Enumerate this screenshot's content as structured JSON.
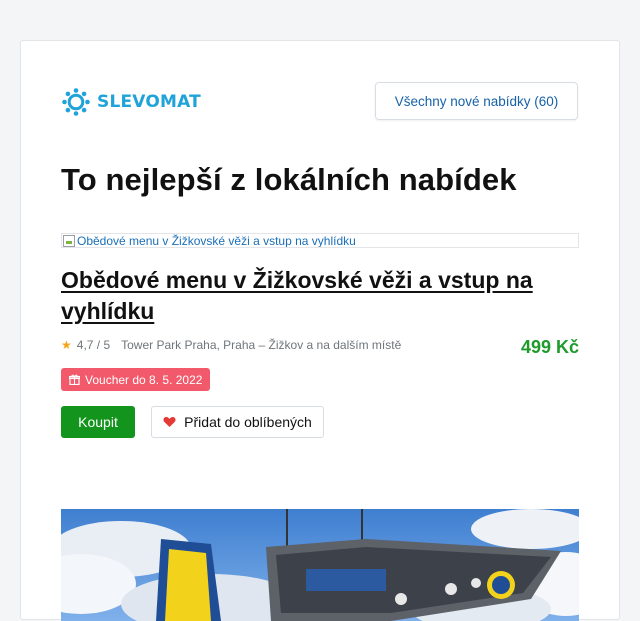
{
  "header": {
    "logo_text": "SLEVOMAT",
    "logo_icon": "gear-icon",
    "all_offers_label": "Všechny nové nabídky (60)"
  },
  "main": {
    "headline": "To nejlepší z lokálních nabídek",
    "offer": {
      "image_alt": "Obědové menu v Žižkovské věži a vstup na vyhlídku",
      "title": "Obědové menu v Žižkovské věži a vstup na vyhlídku",
      "rating": "4,7 / 5",
      "location": "Tower Park Praha, Praha – Žižkov a na dalším místě",
      "price": "499 Kč",
      "voucher": "Voucher do 8. 5. 2022",
      "buy_label": "Koupit",
      "favorite_label": "Přidat do oblíbených"
    }
  },
  "colors": {
    "brand": "#1fa3d8",
    "link": "#1761a9",
    "price": "#1f9b2b",
    "voucher_bg": "#f2596b",
    "buy_bg": "#13941c",
    "heart": "#e53935",
    "star": "#f6a21a"
  }
}
